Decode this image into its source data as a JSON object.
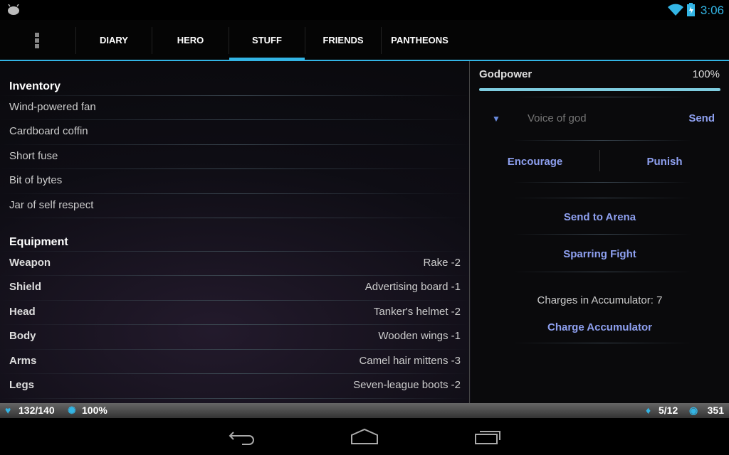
{
  "status_bar": {
    "time": "3:06",
    "icons": [
      "android-icon",
      "wifi-icon",
      "battery-charging-icon"
    ]
  },
  "tabs": [
    {
      "label": "DIARY"
    },
    {
      "label": "HERO"
    },
    {
      "label": "STUFF",
      "active": true
    },
    {
      "label": "FRIENDS"
    },
    {
      "label": "PANTHEONS"
    }
  ],
  "inventory": {
    "title": "Inventory",
    "items": [
      "Wind-powered fan",
      "Cardboard coffin",
      "Short fuse",
      "Bit of bytes",
      "Jar of self respect"
    ]
  },
  "equipment": {
    "title": "Equipment",
    "items": [
      {
        "slot": "Weapon",
        "value": "Rake -2"
      },
      {
        "slot": "Shield",
        "value": "Advertising board -1"
      },
      {
        "slot": "Head",
        "value": "Tanker's helmet -2"
      },
      {
        "slot": "Body",
        "value": "Wooden wings -1"
      },
      {
        "slot": "Arms",
        "value": "Camel hair mittens -3"
      },
      {
        "slot": "Legs",
        "value": "Seven-league boots -2"
      }
    ]
  },
  "godpower": {
    "label": "Godpower",
    "value": "100%",
    "level": 100
  },
  "voice": {
    "placeholder": "Voice of god",
    "send": "Send"
  },
  "actions": {
    "encourage": "Encourage",
    "punish": "Punish",
    "arena": "Send to Arena",
    "sparring": "Sparring Fight",
    "charges": "Charges in Accumulator: 7",
    "charge": "Charge Accumulator"
  },
  "stats": {
    "health": "132/140",
    "godpower": "100%",
    "quest": "5/12",
    "gold": "351"
  },
  "colors": {
    "accent": "#33b5e5",
    "button_text": "#8ea0f0"
  }
}
